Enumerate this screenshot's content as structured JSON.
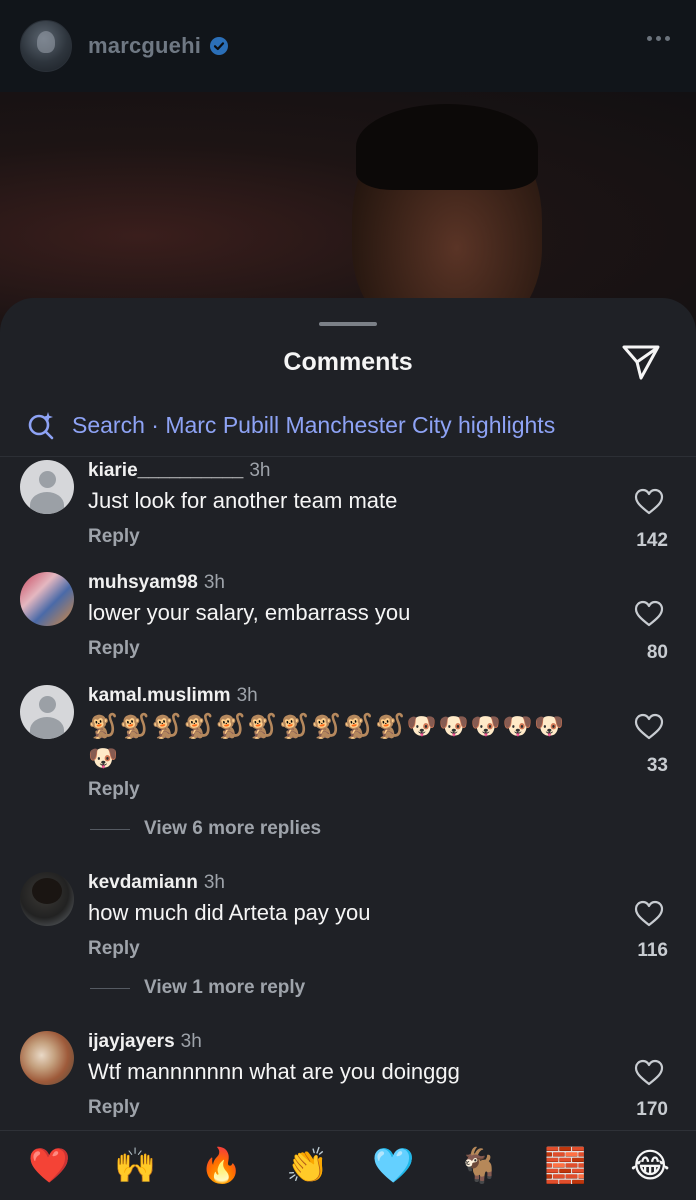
{
  "post": {
    "username": "marcguehi"
  },
  "comments_sheet": {
    "title": "Comments",
    "search_text": "Search · Marc Pubill Manchester City highlights",
    "reply_label": "Reply",
    "comments": [
      {
        "username": "kiarie__________",
        "time": "3h",
        "text": "Just look for another team mate",
        "likes": "142"
      },
      {
        "username": "muhsyam98",
        "time": "3h",
        "text": "lower your salary, embarrass you",
        "likes": "80"
      },
      {
        "username": "kamal.muslimm",
        "time": "3h",
        "text_line1": "🐒🐒🐒🐒🐒🐒🐒🐒🐒🐒🐶🐶🐶🐶🐶",
        "text_line2": "🐶",
        "likes": "33",
        "view_more": "View 6 more replies"
      },
      {
        "username": "kevdamiann",
        "time": "3h",
        "text": "how much did Arteta pay you",
        "likes": "116",
        "view_more": "View 1 more reply"
      },
      {
        "username": "ijayjayers",
        "time": "3h",
        "text": "Wtf mannnnnnn what are you doinggg",
        "likes": "170"
      }
    ]
  },
  "reaction_bar": {
    "emojis": [
      "❤️",
      "🙌",
      "🔥",
      "👏",
      "🩵",
      "🐐",
      "🧱",
      "😂"
    ]
  },
  "colors": {
    "accent_link": "#8ea3f5",
    "verified_badge": "#3897f0",
    "sheet_background": "#1f2126"
  }
}
